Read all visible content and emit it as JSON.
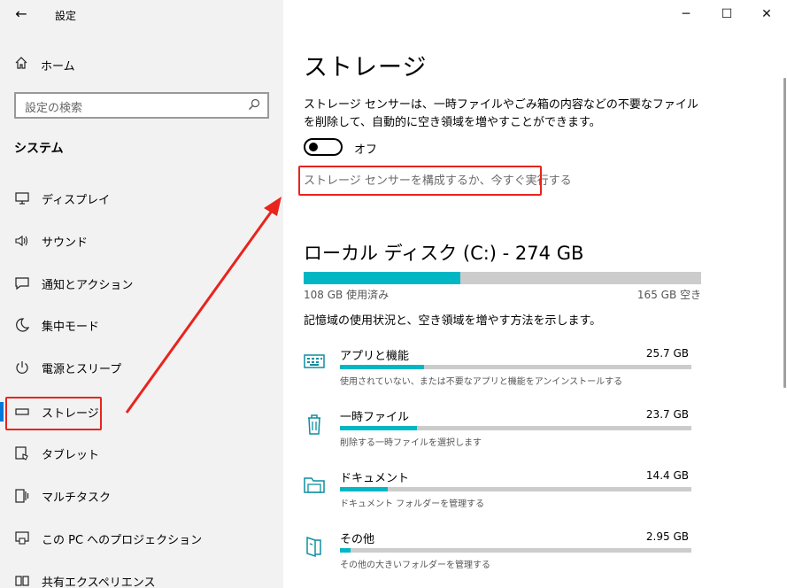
{
  "window": {
    "title": "設定",
    "back_glyph": "←",
    "minimize_glyph": "─",
    "maximize_glyph": "☐",
    "close_glyph": "✕"
  },
  "sidebar": {
    "home_label": "ホーム",
    "search_placeholder": "設定の検索",
    "section_title": "システム",
    "items": [
      {
        "label": "ディスプレイ",
        "icon": "display-icon"
      },
      {
        "label": "サウンド",
        "icon": "speaker-icon"
      },
      {
        "label": "通知とアクション",
        "icon": "notification-icon"
      },
      {
        "label": "集中モード",
        "icon": "moon-icon"
      },
      {
        "label": "電源とスリープ",
        "icon": "power-icon"
      },
      {
        "label": "ストレージ",
        "icon": "storage-icon",
        "active": true
      },
      {
        "label": "タブレット",
        "icon": "tablet-icon"
      },
      {
        "label": "マルチタスク",
        "icon": "multitask-icon"
      },
      {
        "label": "この PC へのプロジェクション",
        "icon": "projection-icon"
      },
      {
        "label": "共有エクスペリエンス",
        "icon": "share-icon"
      }
    ]
  },
  "main": {
    "title": "ストレージ",
    "description": "ストレージ センサーは、一時ファイルやごみ箱の内容などの不要なファイルを削除して、自動的に空き領域を増やすことができます。",
    "toggle_label": "オフ",
    "toggle_on": false,
    "config_link": "ストレージ センサーを構成するか、今すぐ実行する",
    "drive": {
      "title": "ローカル ディスク (C:) - 274 GB",
      "used_label": "108 GB 使用済み",
      "free_label": "165 GB 空き",
      "used_fraction": 0.394
    },
    "usage_description": "記憶域の使用状況と、空き領域を増やす方法を示します。",
    "categories": [
      {
        "name": "アプリと機能",
        "size": "25.7 GB",
        "sub": "使用されていない、または不要なアプリと機能をアンインストールする",
        "fraction": 0.24,
        "icon": "apps-icon"
      },
      {
        "name": "一時ファイル",
        "size": "23.7 GB",
        "sub": "削除する一時ファイルを選択します",
        "fraction": 0.22,
        "icon": "trash-icon"
      },
      {
        "name": "ドキュメント",
        "size": "14.4 GB",
        "sub": "ドキュメント フォルダーを管理する",
        "fraction": 0.135,
        "icon": "folder-icon"
      },
      {
        "name": "その他",
        "size": "2.95 GB",
        "sub": "その他の大きいフォルダーを管理する",
        "fraction": 0.03,
        "icon": "other-icon"
      }
    ]
  },
  "colors": {
    "accent": "#0078d7",
    "bar_fill": "#00b7c3",
    "bar_track": "#cccccc",
    "highlight": "#e8241d",
    "sidebar_bg": "#f2f2f2"
  }
}
